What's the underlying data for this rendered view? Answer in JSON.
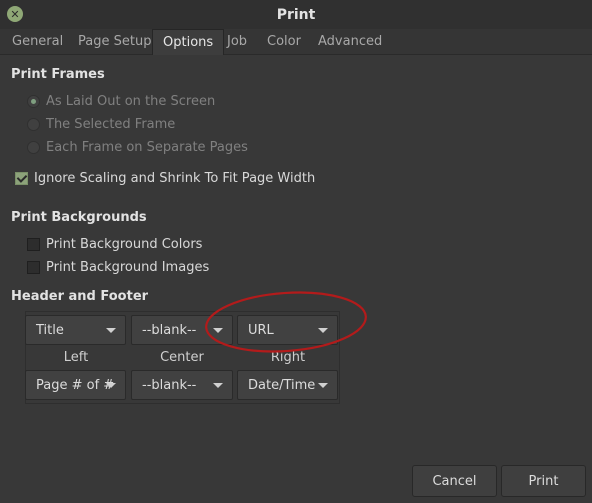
{
  "window": {
    "title": "Print",
    "close_glyph": "✕"
  },
  "tabs": [
    "General",
    "Page Setup",
    "Options",
    "Job",
    "Color",
    "Advanced"
  ],
  "print_frames": {
    "title": "Print Frames",
    "options": [
      "As Laid Out on the Screen",
      "The Selected Frame",
      "Each Frame on Separate Pages"
    ],
    "selected": 0,
    "ignore_scaling": {
      "label": "Ignore Scaling and Shrink To Fit Page Width",
      "checked": true
    }
  },
  "print_backgrounds": {
    "title": "Print Backgrounds",
    "colors": {
      "label": "Print Background Colors",
      "checked": false
    },
    "images": {
      "label": "Print Background Images",
      "checked": false
    }
  },
  "header_footer": {
    "title": "Header and Footer",
    "header": {
      "left": "Title",
      "center": "--blank--",
      "right": "URL"
    },
    "labels": {
      "left": "Left",
      "center": "Center",
      "right": "Right"
    },
    "footer": {
      "left": "Page # of #",
      "center": "--blank--",
      "right": "Date/Time"
    }
  },
  "buttons": {
    "cancel": "Cancel",
    "print": "Print"
  },
  "colors": {
    "accent": "#8ca27a",
    "annotation": "#b31b1b"
  }
}
